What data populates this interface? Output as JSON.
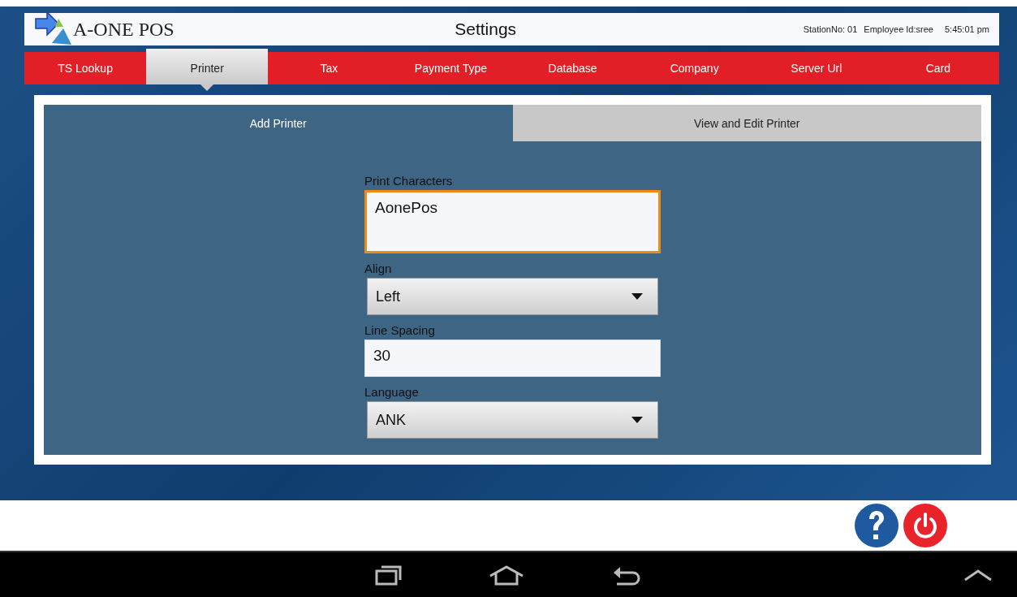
{
  "header": {
    "logo_text": "A-ONE POS",
    "title": "Settings",
    "station": "StationNo: 01",
    "employee": "Employee Id:sree",
    "time": "5:45:01 pm"
  },
  "tabs": [
    {
      "label": "TS Lookup",
      "selected": false
    },
    {
      "label": "Printer",
      "selected": true
    },
    {
      "label": "Tax",
      "selected": false
    },
    {
      "label": "Payment Type",
      "selected": false
    },
    {
      "label": "Database",
      "selected": false
    },
    {
      "label": "Company",
      "selected": false
    },
    {
      "label": "Server Url",
      "selected": false
    },
    {
      "label": "Card",
      "selected": false
    }
  ],
  "subtabs": [
    {
      "label": "Add Printer",
      "selected": true
    },
    {
      "label": "View and Edit Printer",
      "selected": false
    }
  ],
  "fields": [
    {
      "kind": "textarea",
      "label": "Print Characters",
      "value": "AonePos",
      "focused": true
    },
    {
      "kind": "select",
      "label": "Align",
      "value": "Left",
      "focused": false
    },
    {
      "kind": "text",
      "label": "Line Spacing",
      "value": "30",
      "focused": false
    },
    {
      "kind": "select",
      "label": "Language",
      "value": "ANK",
      "focused": false
    }
  ]
}
